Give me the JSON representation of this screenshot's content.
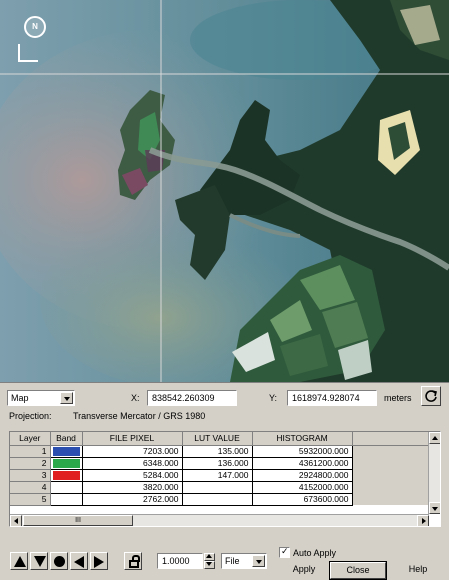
{
  "viewer": {
    "north_arrow_letter": "N",
    "icons": [
      "north-arrow-icon",
      "scale-bar-icon"
    ]
  },
  "controls": {
    "coordinate_type": "Map",
    "x_label": "X:",
    "x_value": "838542.260309",
    "y_label": "Y:",
    "y_value": "1618974.928074",
    "units": "meters",
    "refresh_icon": "refresh-icon",
    "projection_label": "Projection:",
    "projection_value": "Transverse Mercator / GRS 1980"
  },
  "table": {
    "columns": [
      "Layer",
      "Band",
      "FILE PIXEL",
      "LUT VALUE",
      "HISTOGRAM"
    ],
    "rows": [
      {
        "layer": "1",
        "band_color": "#2a4fb0",
        "file_pixel": "7203.000",
        "lut_value": "135.000",
        "histogram": "5932000.000"
      },
      {
        "layer": "2",
        "band_color": "#2aa84a",
        "file_pixel": "6348.000",
        "lut_value": "136.000",
        "histogram": "4361200.000"
      },
      {
        "layer": "3",
        "band_color": "#e02020",
        "file_pixel": "5284.000",
        "lut_value": "147.000",
        "histogram": "2924800.000"
      },
      {
        "layer": "4",
        "band_color": "#ffffff",
        "file_pixel": "3820.000",
        "lut_value": "",
        "histogram": "4152000.000"
      },
      {
        "layer": "5",
        "band_color": "#ffffff",
        "file_pixel": "2762.000",
        "lut_value": "",
        "histogram": "673600.000"
      }
    ],
    "scroll_thumb_label": "III"
  },
  "toolbar": {
    "step_value": "1.0000",
    "source_value": "File",
    "auto_apply_label": "Auto Apply",
    "auto_apply_checked": true,
    "apply_label": "Apply",
    "close_label": "Close",
    "help_label": "Help"
  },
  "colors": {
    "panel_bg": "#d4d0c8",
    "band_blue": "#2a4fb0",
    "band_green": "#2aa84a",
    "band_red": "#e02020"
  }
}
